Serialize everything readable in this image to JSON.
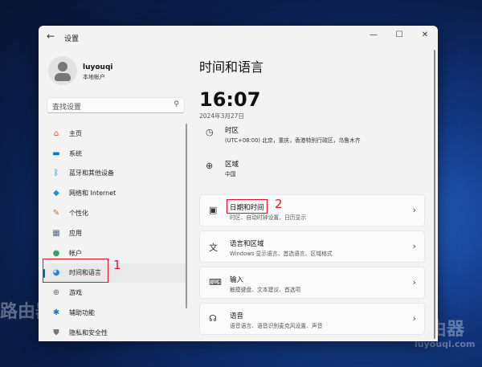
{
  "window": {
    "title": "设置",
    "back": "←",
    "minimize": "—",
    "maximize": "☐",
    "close": "✕"
  },
  "user": {
    "name": "luyouqi",
    "type": "本地帐户"
  },
  "search": {
    "placeholder": "查找设置",
    "icon": "search-icon"
  },
  "nav": [
    {
      "label": "主页",
      "icon": "home-icon",
      "color": "#d9572b"
    },
    {
      "label": "系统",
      "icon": "monitor-icon",
      "color": "#0078d4"
    },
    {
      "label": "蓝牙和其他设备",
      "icon": "bluetooth-icon",
      "color": "#0078d4"
    },
    {
      "label": "网络和 Internet",
      "icon": "wifi-icon",
      "color": "#2b88d8"
    },
    {
      "label": "个性化",
      "icon": "brush-icon",
      "color": "#c0762a"
    },
    {
      "label": "应用",
      "icon": "apps-icon",
      "color": "#5b6b7b"
    },
    {
      "label": "帐户",
      "icon": "account-icon",
      "color": "#2fa36b"
    },
    {
      "label": "时间和语言",
      "icon": "globe-clock-icon",
      "color": "#1f8ad2"
    },
    {
      "label": "游戏",
      "icon": "gamepad-icon",
      "color": "#666"
    },
    {
      "label": "辅助功能",
      "icon": "accessibility-icon",
      "color": "#1a73c8"
    },
    {
      "label": "隐私和安全性",
      "icon": "shield-icon",
      "color": "#777"
    }
  ],
  "page": {
    "title": "时间和语言",
    "time": "16:07",
    "date": "2024年3月27日"
  },
  "info": [
    {
      "title": "时区",
      "sub": "(UTC+08:00) 北京，重庆，香港特别行政区，乌鲁木齐",
      "icon": "clock-globe-icon"
    },
    {
      "title": "区域",
      "sub": "中国",
      "icon": "globe-icon"
    }
  ],
  "cards": [
    {
      "title": "日期和时间",
      "sub": "时区、自动时钟设置、日历显示",
      "icon": "calendar-clock-icon"
    },
    {
      "title": "语言和区域",
      "sub": "Windows 显示语言、首选语言、区域格式",
      "icon": "language-icon"
    },
    {
      "title": "输入",
      "sub": "触摸键盘、文本建议、首选项",
      "icon": "keyboard-icon"
    },
    {
      "title": "语音",
      "sub": "语音语言、语音识别麦克风设置、声音",
      "icon": "speech-icon"
    }
  ],
  "annotations": {
    "one": "1",
    "two": "2"
  },
  "watermark": {
    "brand": "路由器",
    "site": "luyouqi.com"
  }
}
